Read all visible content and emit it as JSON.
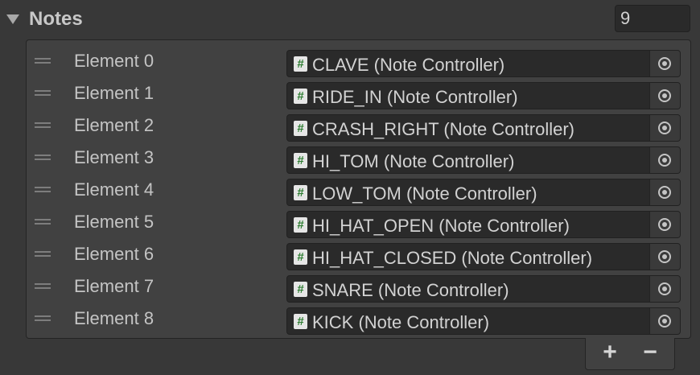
{
  "header": {
    "title": "Notes",
    "size_value": "9"
  },
  "list": {
    "elements": [
      {
        "label": "Element 0",
        "value": "CLAVE (Note Controller)"
      },
      {
        "label": "Element 1",
        "value": "RIDE_IN (Note Controller)"
      },
      {
        "label": "Element 2",
        "value": "CRASH_RIGHT (Note Controller)"
      },
      {
        "label": "Element 3",
        "value": "HI_TOM (Note Controller)"
      },
      {
        "label": "Element 4",
        "value": "LOW_TOM (Note Controller)"
      },
      {
        "label": "Element 5",
        "value": "HI_HAT_OPEN (Note Controller)"
      },
      {
        "label": "Element 6",
        "value": "HI_HAT_CLOSED (Note Controller)"
      },
      {
        "label": "Element 7",
        "value": "SNARE (Note Controller)"
      },
      {
        "label": "Element 8",
        "value": "KICK (Note Controller)"
      }
    ],
    "script_icon_glyph": "#"
  },
  "footer": {
    "add_label": "+",
    "remove_label": "−"
  },
  "icons": {
    "foldout": "triangle-down-icon",
    "drag": "drag-handle-icon",
    "script": "cs-script-icon",
    "picker": "object-picker-icon"
  },
  "colors": {
    "background": "#383838",
    "list_background": "#414141",
    "field_background": "#2a2a2a",
    "script_icon_green": "#2e7d32"
  }
}
